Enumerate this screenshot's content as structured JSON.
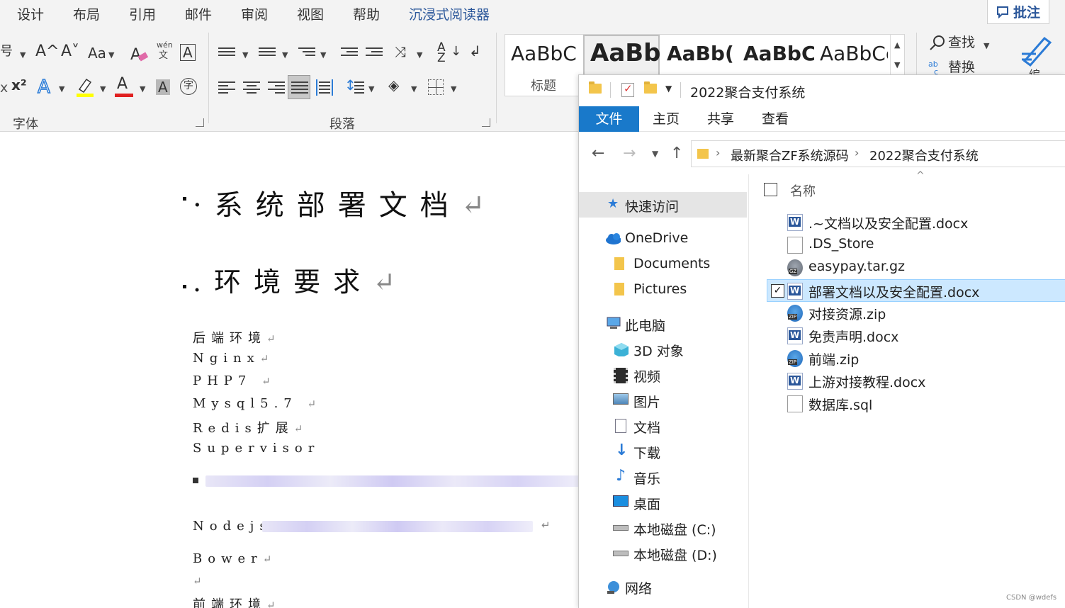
{
  "word": {
    "tabs": [
      "设计",
      "布局",
      "引用",
      "邮件",
      "审阅",
      "视图",
      "帮助",
      "沉浸式阅读器"
    ],
    "comment_button": "批注",
    "ribbon": {
      "font_size_fragment": "号",
      "grow_font": "A^",
      "shrink_font": "A˅",
      "change_case": "Aa",
      "phonetic_top": "wén",
      "phonetic_bottom": "文",
      "border_char": "A",
      "superscript": "x²",
      "font_color_char": "A",
      "shade_char": "A",
      "enclose_char": "字",
      "font_group_label": "字体",
      "paragraph_group_label": "段落",
      "find_label": "查找",
      "replace_label": "替换",
      "styles": [
        {
          "sample": "AaBbC",
          "name": "标题"
        },
        {
          "sample": "AaBb",
          "name": ""
        },
        {
          "sample": "AaBb(",
          "name": ""
        },
        {
          "sample": "AaBbC",
          "name": ""
        },
        {
          "sample": "AaBbCc",
          "name": ""
        }
      ],
      "edit_partial": "编"
    }
  },
  "document": {
    "title": "·系统部署文档",
    "heading2": ".环境要求",
    "para_mark": "↵",
    "lines": [
      "后端环境",
      "Nginx",
      "PHP7",
      "Mysql5.7",
      "Redis扩展",
      "Supervisor",
      "",
      "Nodejs",
      "Bower",
      "",
      "前端环境"
    ]
  },
  "explorer": {
    "window_title": "2022聚合支付系统",
    "tabs": [
      "文件",
      "主页",
      "共享",
      "查看"
    ],
    "breadcrumb": [
      "最新聚合ZF系统源码",
      "2022聚合支付系统"
    ],
    "column_name": "名称",
    "nav": [
      {
        "label": "快速访问",
        "icon": "star-icon"
      },
      {
        "label": "OneDrive",
        "icon": "cloud-icon"
      },
      {
        "label": "Documents",
        "icon": "folder-icon"
      },
      {
        "label": "Pictures",
        "icon": "folder-icon"
      },
      {
        "label": "此电脑",
        "icon": "computer-icon"
      },
      {
        "label": "3D 对象",
        "icon": "cube-icon"
      },
      {
        "label": "视频",
        "icon": "film-icon"
      },
      {
        "label": "图片",
        "icon": "picture-icon"
      },
      {
        "label": "文档",
        "icon": "document-icon"
      },
      {
        "label": "下载",
        "icon": "download-icon"
      },
      {
        "label": "音乐",
        "icon": "music-icon"
      },
      {
        "label": "桌面",
        "icon": "desktop-icon"
      },
      {
        "label": "本地磁盘 (C:)",
        "icon": "drive-icon"
      },
      {
        "label": "本地磁盘 (D:)",
        "icon": "drive-icon"
      },
      {
        "label": "网络",
        "icon": "network-icon"
      }
    ],
    "files": [
      {
        "name": ".~文档以及安全配置.docx",
        "type": "word"
      },
      {
        "name": ".DS_Store",
        "type": "blank"
      },
      {
        "name": "easypay.tar.gz",
        "type": "gz"
      },
      {
        "name": "部署文档以及安全配置.docx",
        "type": "word",
        "selected": true
      },
      {
        "name": "对接资源.zip",
        "type": "zip"
      },
      {
        "name": "免责声明.docx",
        "type": "word"
      },
      {
        "name": "前端.zip",
        "type": "zip"
      },
      {
        "name": "上游对接教程.docx",
        "type": "word"
      },
      {
        "name": "数据库.sql",
        "type": "blank"
      }
    ]
  },
  "watermark": "CSDN @wdefs",
  "colors": {
    "word_accent": "#2b579a",
    "explorer_file_tab": "#1979ca",
    "selection": "#cce8ff"
  }
}
